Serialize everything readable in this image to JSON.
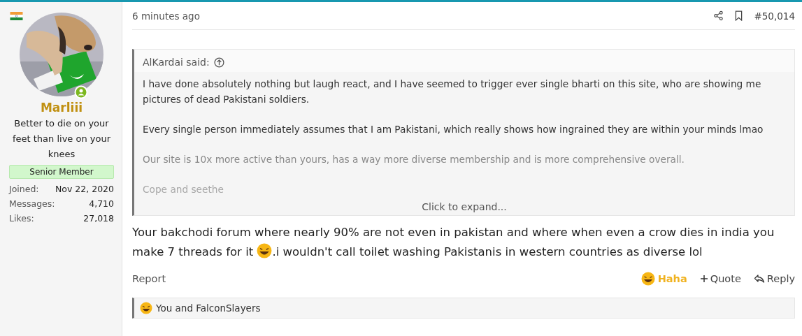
{
  "user": {
    "name": "Marliii",
    "online": true,
    "title": "Better to die on your feet than live on your knees",
    "rank": "Senior Member",
    "stats": [
      {
        "label": "Joined:",
        "value": "Nov 22, 2020"
      },
      {
        "label": "Messages:",
        "value": "4,710"
      },
      {
        "label": "Likes:",
        "value": "27,018"
      }
    ]
  },
  "post": {
    "time": "6 minutes ago",
    "number": "#50,014",
    "quote": {
      "author": "AlKardai said:",
      "paragraphs": [
        "I have done absolutely nothing but laugh react, and I have seemed to trigger ever single bharti on this site, who are showing me pictures of dead Pakistani soldiers.",
        "Every single person immediately assumes that I am Pakistani, which really shows how ingrained they are within your minds lmao",
        "Our site is 10x more active than yours, has a way more diverse membership and is more comprehensive overall.",
        "Cope and seethe"
      ],
      "expand": "Click to expand..."
    },
    "body_before": "Your bakchodi forum where nearly 90% are not even in pakistan and where when even a crow dies in india you make 7 threads for it",
    "body_after": ".i wouldn't call toilet washing Pakistanis in western countries as diverse lol",
    "report": "Report",
    "reaction": {
      "label": "Haha",
      "selected": true
    },
    "quote_button": "Quote",
    "reply": "Reply",
    "reactions_summary": "You and FalconSlayers"
  }
}
